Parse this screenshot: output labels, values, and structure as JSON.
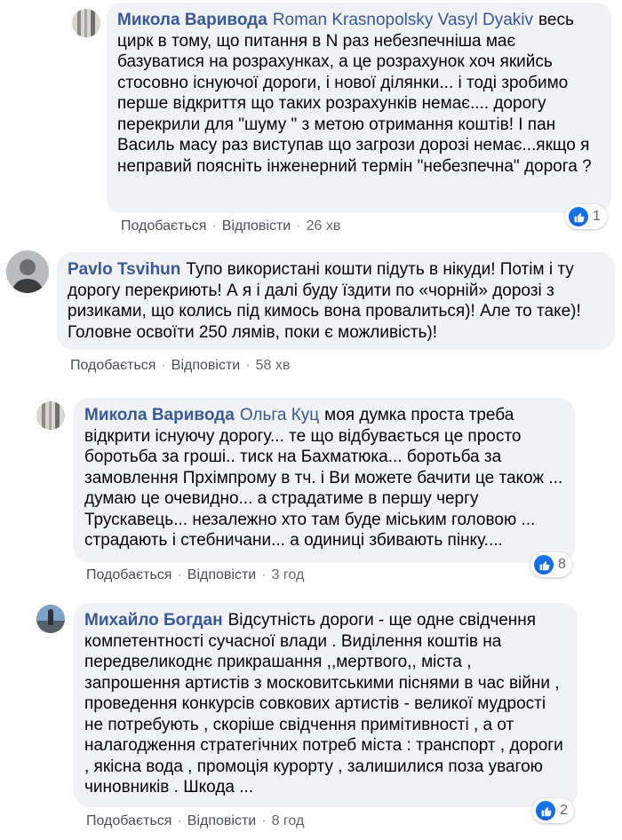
{
  "actions": {
    "like_label": "Подобається",
    "reply_label": "Відповісти",
    "separator": "·"
  },
  "comments": [
    {
      "author": "Микола Варивода",
      "mentions": "Roman Krasnopolsky Vasyl Dyakiv",
      "text": "весь цирк в тому, що питання в N раз небезпечніша має базуватися на розрахунках, а це розрахунок хоч якийсь стосовно існуючої дороги, і нової ділянки... і тоді зробимо перше відкриття що таких розрахунків немає.... дорогу перекрили для \"шуму \" з метою отримання коштів! І пан Василь масу раз виступав що загрози дорозі немає...якщо я неправий поясніть інженерний термін \"небезпечна\" дорога ?",
      "time": "26 хв",
      "likes": "1"
    },
    {
      "author": "Pavlo Tsvihun",
      "mentions": "",
      "text": "Тупо використані кошти підуть в нікуди! Потім і ту дорогу перекриють! А я і далі буду їздити по «чорній» дорозі з ризиками, що колись під кимось вона провалиться)! Але то таке)! Головне освоїти 250 лямів, поки є можливість)!",
      "time": "58 хв",
      "likes": ""
    },
    {
      "author": "Микола Варивода",
      "mentions": "Ольга Куц",
      "text": "моя думка проста треба відкрити існуючу дорогу... те що відбувається це просто боротьба за гроші.. тиск на Бахматюка... боротьба за замовлення Пpхімпрому в тч. і Ви можете бачити це також ... думаю це очевидно... а страдатиме в першу чергу Трускавець... незалежно хто там буде міським головою ... страдають і стебничани... а одиниці збивають пінку....",
      "time": "3 год",
      "likes": "8"
    },
    {
      "author": "Михайло Богдан",
      "mentions": "",
      "text": "Відсутність дороги - ще одне свідчення компетентності сучасної влади . Виділення коштів на передвеликоднє прикрашання ,,мертвого,, міста , запрошення артистів з московитськими піснями в час війни , проведення конкурсів совкових артистів - великої мудрості не потребують , скоріше свідчення примітивності , а от налагодження стратегічних потреб міста : транспорт , дороги , якісна вода , промоція курорту , залишилися поза увагою чиновників . Шкода ...",
      "time": "8 год",
      "likes": "2"
    }
  ]
}
